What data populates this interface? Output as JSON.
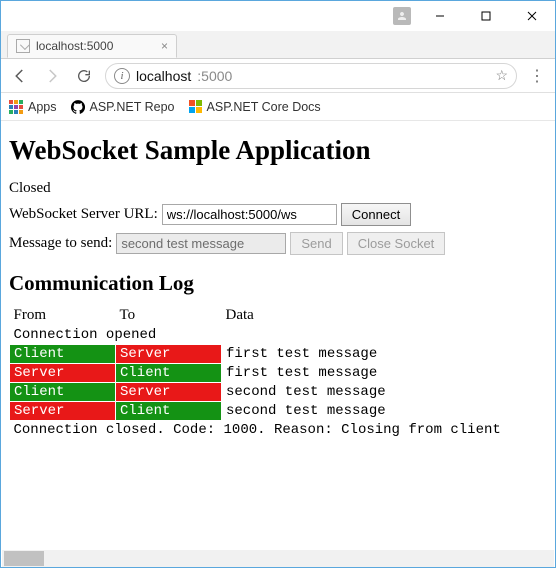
{
  "window": {
    "tab_title": "localhost:5000",
    "url_host": "localhost",
    "url_path": ":5000"
  },
  "bookmarks": {
    "apps_label": "Apps",
    "item1_label": "ASP.NET Repo",
    "item2_label": "ASP.NET Core Docs"
  },
  "page": {
    "title": "WebSocket Sample Application",
    "status": "Closed",
    "url_label": "WebSocket Server URL:",
    "url_value": "ws://localhost:5000/ws",
    "connect_label": "Connect",
    "msg_label": "Message to send:",
    "msg_value": "second test message",
    "send_label": "Send",
    "close_label": "Close Socket",
    "log_heading": "Communication Log",
    "col_from": "From",
    "col_to": "To",
    "col_data": "Data",
    "open_line": "Connection opened",
    "rows": [
      {
        "from": "Client",
        "to": "Server",
        "data": "first test message"
      },
      {
        "from": "Server",
        "to": "Client",
        "data": "first test message"
      },
      {
        "from": "Client",
        "to": "Server",
        "data": "second test message"
      },
      {
        "from": "Server",
        "to": "Client",
        "data": "second test message"
      }
    ],
    "close_line": "Connection closed. Code: 1000. Reason: Closing from client"
  }
}
